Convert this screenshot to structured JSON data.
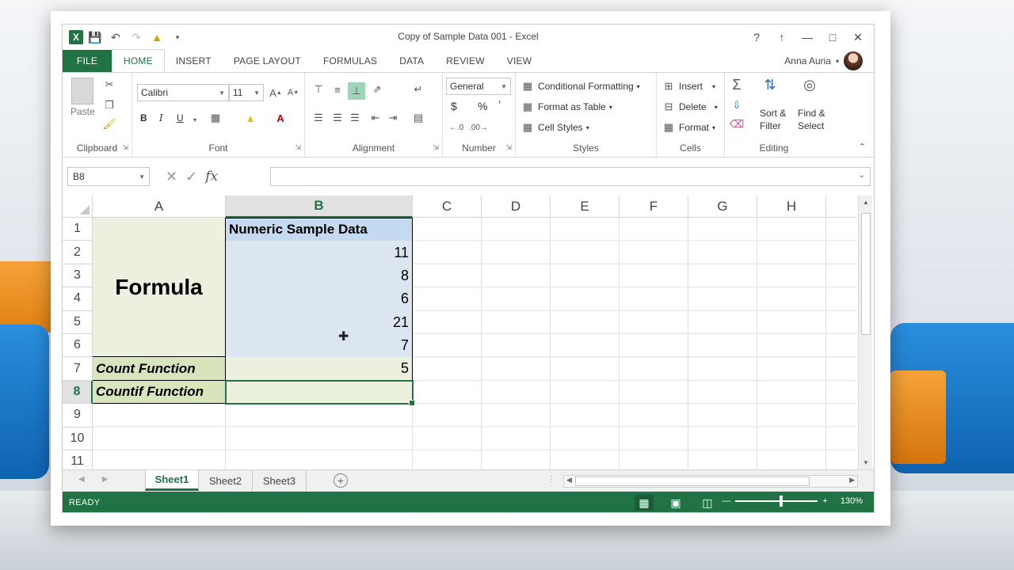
{
  "window": {
    "title": "Copy of Sample Data 001 - Excel"
  },
  "title_controls": {
    "help": "?",
    "ribbon_options": "↑",
    "minimize": "—",
    "maximize": "□",
    "close": "✕"
  },
  "tabs": [
    "FILE",
    "HOME",
    "INSERT",
    "PAGE LAYOUT",
    "FORMULAS",
    "DATA",
    "REVIEW",
    "VIEW"
  ],
  "active_tab": "HOME",
  "user": {
    "name": "Anna Auria"
  },
  "ribbon": {
    "clipboard": {
      "label": "Clipboard",
      "paste": "Paste"
    },
    "font": {
      "label": "Font",
      "font_name": "Calibri",
      "font_size": "11",
      "bold": "B",
      "italic": "I",
      "underline": "U"
    },
    "alignment": {
      "label": "Alignment"
    },
    "number": {
      "label": "Number",
      "format": "General",
      "currency": "$",
      "percent": "%",
      "comma": "’"
    },
    "styles": {
      "label": "Styles",
      "conditional": "Conditional Formatting",
      "format_table": "Format as Table",
      "cell_styles": "Cell Styles"
    },
    "cells": {
      "label": "Cells",
      "insert": "Insert",
      "delete": "Delete",
      "format": "Format"
    },
    "editing": {
      "label": "Editing",
      "sort": "Sort &",
      "filter": "Filter",
      "find": "Find &",
      "select": "Select"
    }
  },
  "formula_bar": {
    "name_box": "B8",
    "formula": ""
  },
  "columns": [
    "A",
    "B",
    "C",
    "D",
    "E",
    "F",
    "G",
    "H"
  ],
  "rows": [
    "1",
    "2",
    "3",
    "4",
    "5",
    "6",
    "7",
    "8",
    "9",
    "10",
    "11"
  ],
  "cells": {
    "A1_merged": "Formula",
    "B1": "Numeric Sample Data",
    "B_values": [
      "11",
      "8",
      "6",
      "21",
      "7"
    ],
    "A7": "Count Function",
    "B7": "5",
    "A8": "Countif Function",
    "B8": ""
  },
  "sheets": [
    "Sheet1",
    "Sheet2",
    "Sheet3"
  ],
  "active_sheet": "Sheet1",
  "status": {
    "ready": "READY",
    "zoom": "130%",
    "zoom_level_percent": 130
  },
  "colors": {
    "excel_green": "#217346",
    "header_blue": "#c5d9f1",
    "data_blue": "#dce6f1",
    "label_green": "#d8e4bc",
    "formula_green": "#ebf1de"
  }
}
